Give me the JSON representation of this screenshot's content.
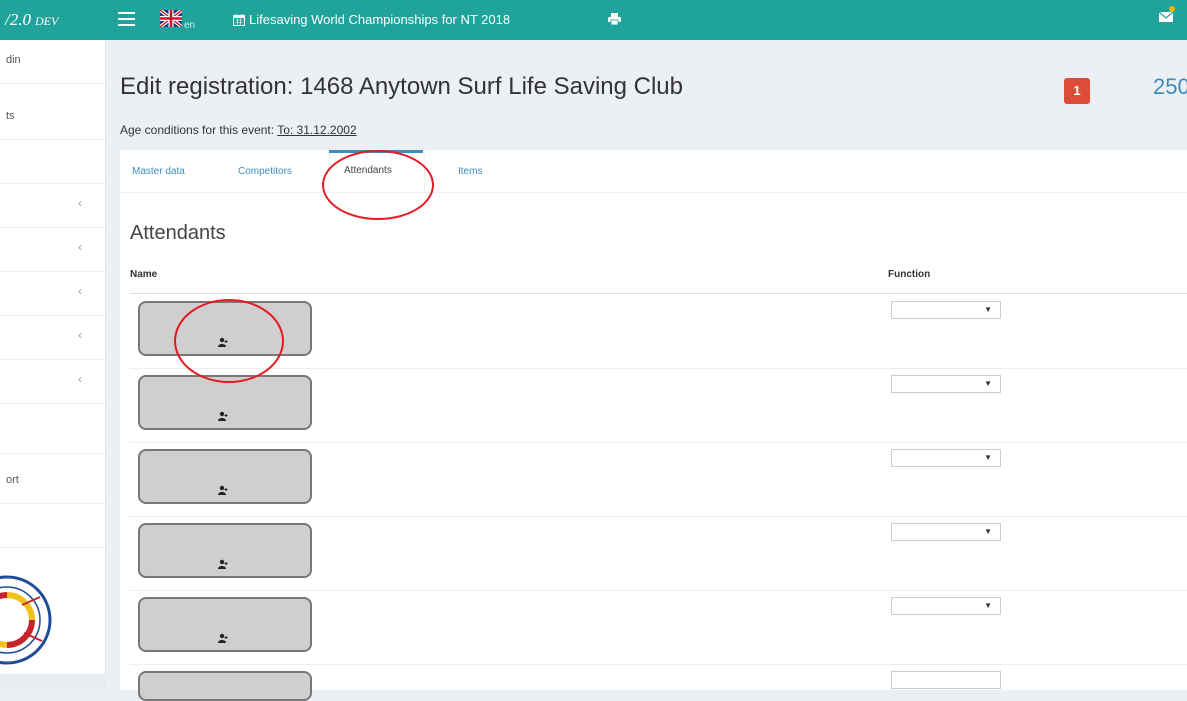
{
  "topbar": {
    "brand": "/2.0",
    "brand_suffix": "DEV",
    "language": "en",
    "event_title": "Lifesaving World Championships for NT 2018"
  },
  "sidebar": {
    "items": [
      {
        "label": "din",
        "chevron": false
      },
      {
        "label": "ts",
        "chevron": false
      },
      {
        "label": "",
        "chevron": false
      },
      {
        "label": "",
        "chevron": true
      },
      {
        "label": "",
        "chevron": true
      },
      {
        "label": "",
        "chevron": true
      },
      {
        "label": "",
        "chevron": true
      },
      {
        "label": "",
        "chevron": true
      },
      {
        "label": "",
        "chevron": false
      },
      {
        "label": "ort",
        "chevron": false
      },
      {
        "label": "",
        "chevron": false
      }
    ],
    "chevron_glyph": "‹"
  },
  "page": {
    "title": "Edit registration: 1468 Anytown Surf Life Saving Club",
    "badge_count": "1",
    "points": "250",
    "age_conditions_label": "Age conditions for this event: ",
    "age_conditions_value": "To: 31.12.2002"
  },
  "tabs": [
    {
      "label": "Master data",
      "active": false
    },
    {
      "label": "Competitors",
      "active": false
    },
    {
      "label": "Attendants",
      "active": true
    },
    {
      "label": "Items",
      "active": false
    }
  ],
  "attendants": {
    "section_title": "Attendants",
    "columns": {
      "name": "Name",
      "function": "Function"
    },
    "rows": [
      {
        "function_value": ""
      },
      {
        "function_value": ""
      },
      {
        "function_value": ""
      },
      {
        "function_value": ""
      },
      {
        "function_value": ""
      }
    ]
  },
  "colors": {
    "topbar": "#1fa39a",
    "accent": "#3c8dbc",
    "badge": "#dd4b39",
    "annotation": "#e31b23"
  },
  "icons": {
    "menu": "hamburger-icon",
    "flag": "uk-flag-icon",
    "calendar": "calendar-icon",
    "print": "print-icon",
    "mail": "envelope-icon",
    "person": "person-add-icon"
  }
}
